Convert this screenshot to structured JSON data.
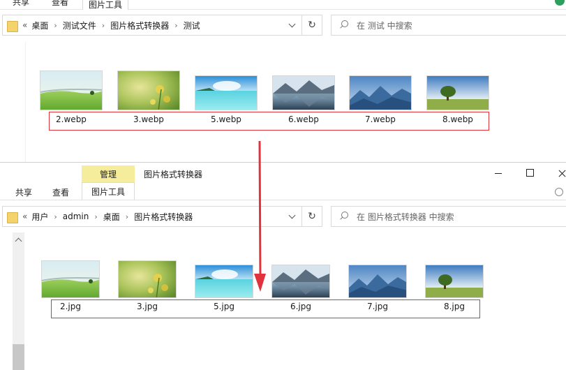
{
  "top_window": {
    "ribbon_tabs": [
      "共享",
      "查看",
      "图片工具"
    ],
    "address": {
      "lead": "«",
      "crumbs": [
        "桌面",
        "测试文件",
        "图片格式转换器",
        "测试"
      ]
    },
    "search_placeholder": "在 测试 中搜索",
    "files": [
      {
        "name": "2.webp",
        "thumb": "green-field-icon"
      },
      {
        "name": "3.webp",
        "thumb": "yellow-flowers-icon"
      },
      {
        "name": "5.webp",
        "thumb": "tropical-sea-icon"
      },
      {
        "name": "6.webp",
        "thumb": "mountain-lake-icon"
      },
      {
        "name": "7.webp",
        "thumb": "blue-mountains-icon"
      },
      {
        "name": "8.webp",
        "thumb": "lone-tree-icon"
      }
    ]
  },
  "bottom_window": {
    "title": "图片格式转换器",
    "context_tab": "管理",
    "ribbon_tabs": [
      "共享",
      "查看",
      "图片工具"
    ],
    "address": {
      "lead": "«",
      "crumbs": [
        "用户",
        "admin",
        "桌面",
        "图片格式转换器"
      ]
    },
    "search_placeholder": "在 图片格式转换器 中搜索",
    "files": [
      {
        "name": "2.jpg",
        "thumb": "green-field-icon"
      },
      {
        "name": "3.jpg",
        "thumb": "yellow-flowers-icon"
      },
      {
        "name": "5.jpg",
        "thumb": "tropical-sea-icon"
      },
      {
        "name": "6.jpg",
        "thumb": "mountain-lake-icon"
      },
      {
        "name": "7.jpg",
        "thumb": "blue-mountains-icon"
      },
      {
        "name": "8.jpg",
        "thumb": "lone-tree-icon"
      }
    ]
  },
  "colors": {
    "highlight_red": "#e0333c",
    "context_tab_yellow": "#f6ed9c",
    "folder_yellow": "#f5d36c"
  }
}
